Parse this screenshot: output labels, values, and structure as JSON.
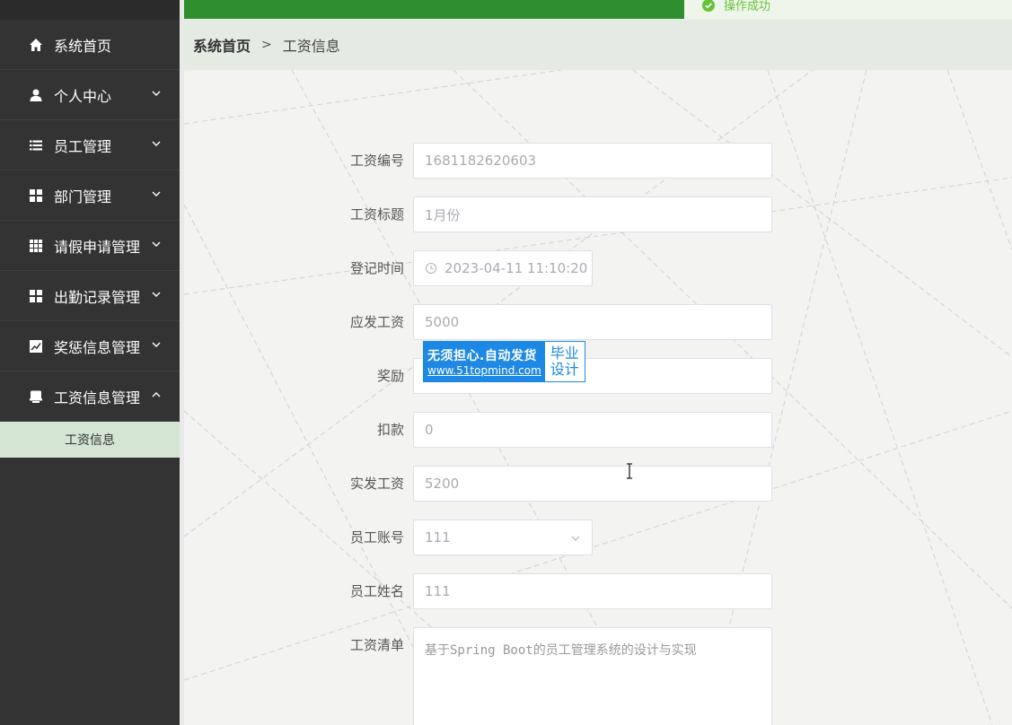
{
  "sidebar": {
    "items": [
      {
        "label": "系统首页",
        "icon": "home-icon",
        "has_submenu": false
      },
      {
        "label": "个人中心",
        "icon": "user-icon",
        "has_submenu": true
      },
      {
        "label": "员工管理",
        "icon": "list-icon",
        "has_submenu": true
      },
      {
        "label": "部门管理",
        "icon": "grid-icon",
        "has_submenu": true
      },
      {
        "label": "请假申请管理",
        "icon": "apps-icon",
        "has_submenu": true
      },
      {
        "label": "出勤记录管理",
        "icon": "grid-icon",
        "has_submenu": true
      },
      {
        "label": "奖惩信息管理",
        "icon": "chart-icon",
        "has_submenu": true
      },
      {
        "label": "工资信息管理",
        "icon": "printer-icon",
        "has_submenu": true,
        "expanded": true
      }
    ],
    "sub_items": [
      {
        "label": "工资信息",
        "active": true
      }
    ]
  },
  "toast": {
    "text": "操作成功",
    "color": "#67c23a"
  },
  "breadcrumb": {
    "home": "系统首页",
    "separator": ">",
    "current": "工资信息"
  },
  "form": {
    "salary_no": {
      "label": "工资编号",
      "value": "1681182620603"
    },
    "salary_title": {
      "label": "工资标题",
      "value": "1月份"
    },
    "register_time": {
      "label": "登记时间",
      "value": "2023-04-11 11:10:20"
    },
    "payable": {
      "label": "应发工资",
      "value": "5000"
    },
    "bonus": {
      "label": "奖励",
      "value": ""
    },
    "deduction": {
      "label": "扣款",
      "value": "0"
    },
    "actual": {
      "label": "实发工资",
      "value": "5200"
    },
    "employee_account": {
      "label": "员工账号",
      "value": "111"
    },
    "employee_name": {
      "label": "员工姓名",
      "value": "111"
    },
    "salary_list": {
      "label": "工资清单",
      "value": "基于Spring Boot的员工管理系统的设计与实现"
    }
  },
  "watermark": {
    "line1": "无须担心.自动发货",
    "line2": "www.51topmind.com",
    "right_line1": "毕业",
    "right_line2": "设计"
  },
  "colors": {
    "sidebar_bg": "#333333",
    "accent_green": "#2f8f2f",
    "submenu_active": "#d4e6d3",
    "watermark_blue": "#1e88e5"
  }
}
